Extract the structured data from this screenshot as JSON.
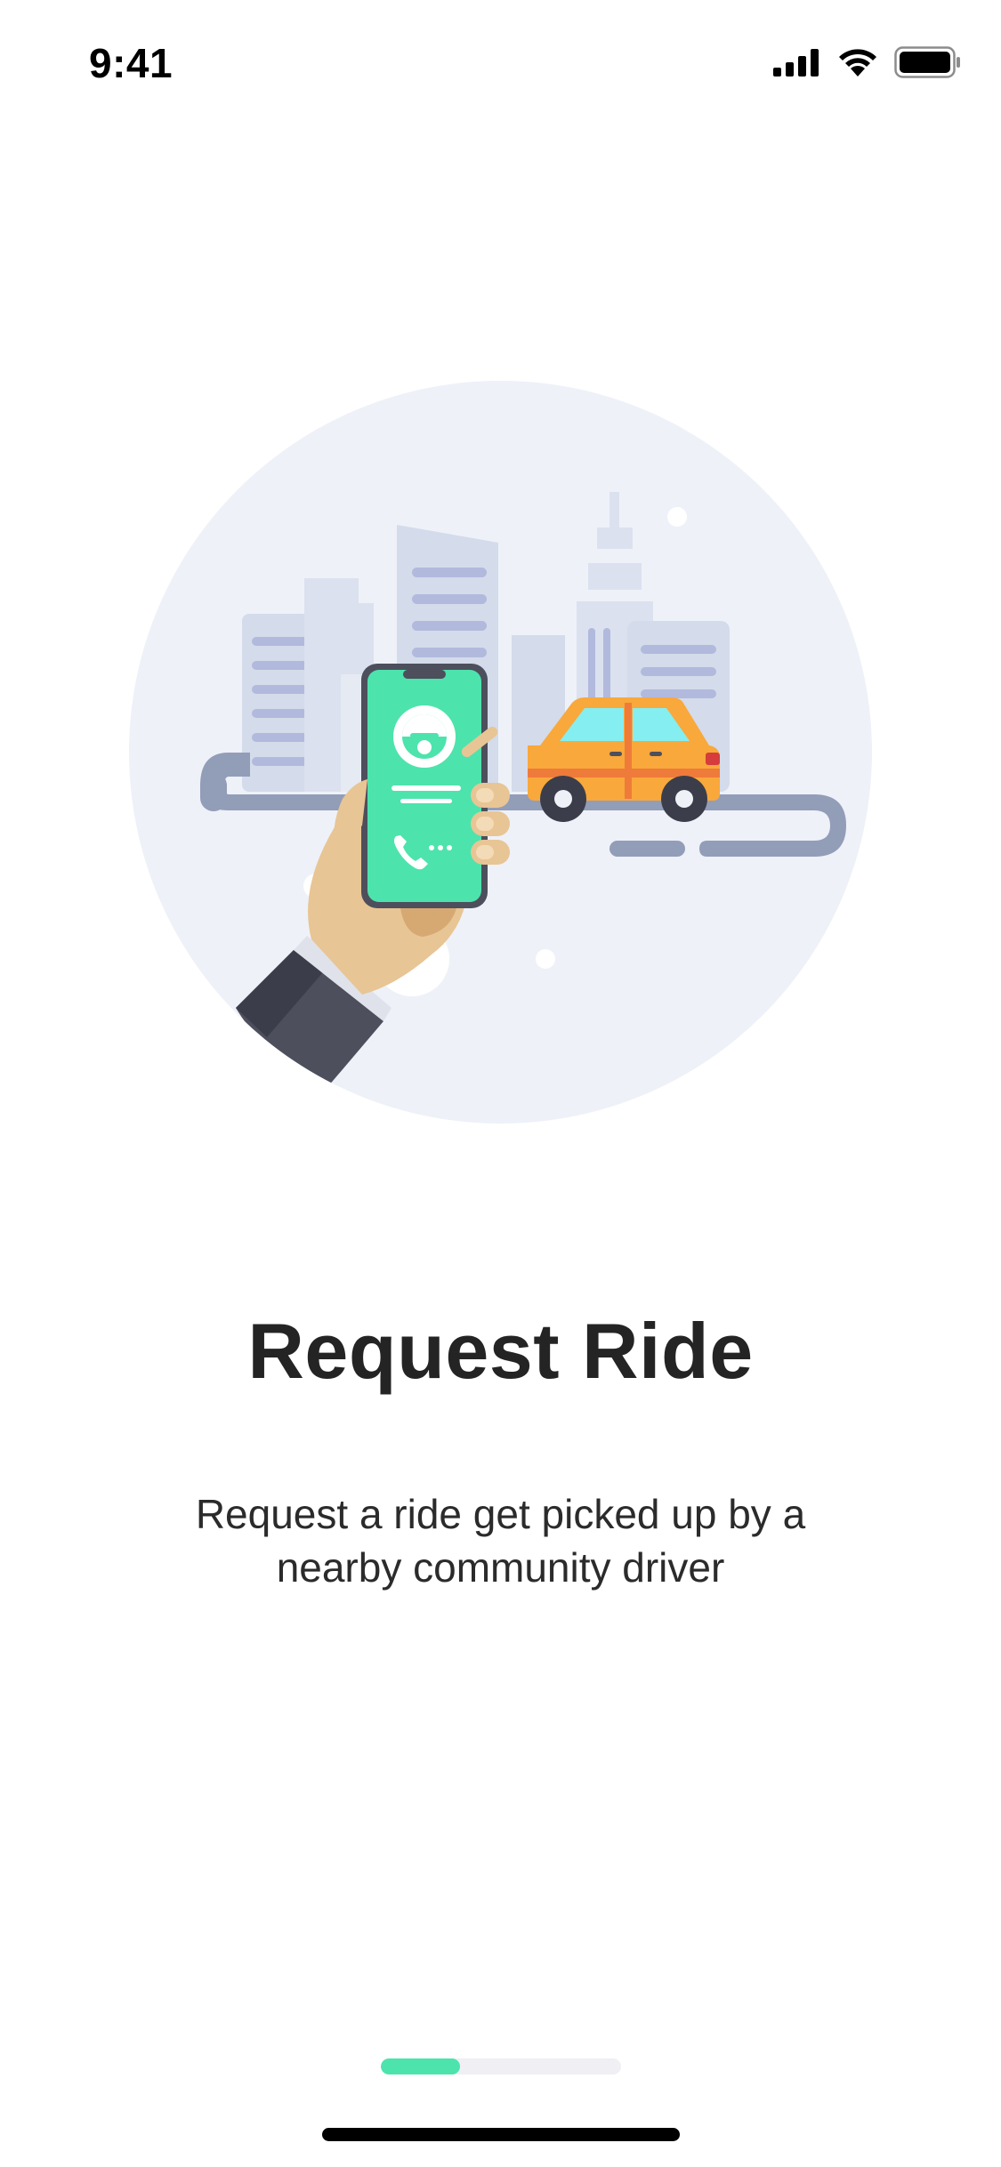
{
  "status_bar": {
    "time": "9:41",
    "icons": [
      "cellular-signal-icon",
      "wifi-icon",
      "battery-icon"
    ]
  },
  "illustration": {
    "description_icons": [
      "hand-holding-phone-icon",
      "car-icon",
      "city-skyline-icon",
      "road-icon"
    ],
    "colors": {
      "circle_bg": "#eef1f8",
      "buildings": "#d4dbea",
      "road": "#929db8",
      "phone_screen": "#4de3ad",
      "car_body": "#f9a83b",
      "car_window": "#85eef0",
      "skin": "#e8c594",
      "sleeve": "#4d4f5c"
    }
  },
  "onboarding": {
    "title": "Request Ride",
    "description": "Request a ride get picked up by a nearby community driver"
  },
  "pager": {
    "current_page": 1,
    "total_pages": 3,
    "progress_fraction": 0.33,
    "colors": {
      "active": "#4de3ad",
      "track": "#efeff4"
    }
  }
}
